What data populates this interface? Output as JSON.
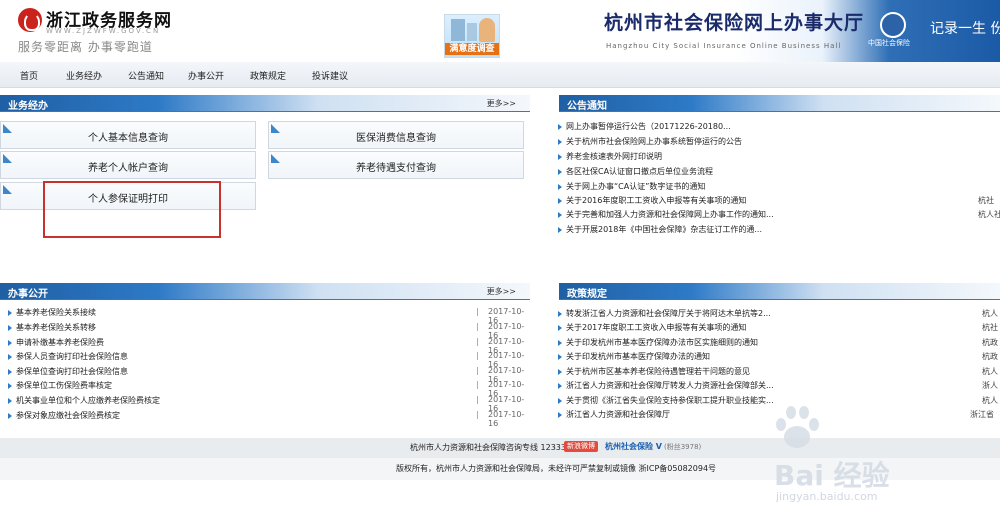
{
  "header": {
    "logo_name": "浙江政务服务网",
    "logo_url": "WWW.ZJZWFW.GOV.CN",
    "slogan": "服务零距离 办事零跑道",
    "badge_text": "满意度调查",
    "banner_title": "杭州市社会保险网上办事大厅",
    "banner_subtitle": "Hangzhou City Social Insurance Online Business Hall",
    "si_logo_text": "中国社会保险",
    "banner_right": "记录一生 份"
  },
  "nav": {
    "items": [
      "首页",
      "业务经办",
      "公告通知",
      "办事公开",
      "政策规定",
      "投诉建议"
    ]
  },
  "business": {
    "title": "业务经办",
    "more": "更多>>",
    "services": [
      "个人基本信息查询",
      "医保消费信息查询",
      "养老个人帐户查询",
      "养老待遇支付查询",
      "个人参保证明打印"
    ]
  },
  "notices": {
    "title": "公告通知",
    "more": "更多>>",
    "items": [
      {
        "text": "网上办事暂停运行公告（20171226-20180...",
        "src": ""
      },
      {
        "text": "关于杭州市社会保险网上办事系统暂停运行的公告",
        "src": ""
      },
      {
        "text": "养老金核速表外网打印说明",
        "src": ""
      },
      {
        "text": "各区社保CA认证窗口撤点后单位业务流程",
        "src": ""
      },
      {
        "text": "关于网上办事“CA认证”数字证书的通知",
        "src": ""
      },
      {
        "text": "关于2016年度职工工资收入申报等有关事项的通知",
        "src": "杭社"
      },
      {
        "text": "关于完善和加强人力资源和社会保障网上办事工作的通知...",
        "src": "杭人社"
      },
      {
        "text": "关于开展2018年《中国社会保障》杂志征订工作的通...",
        "src": ""
      }
    ]
  },
  "disclosure": {
    "title": "办事公开",
    "more": "更多>>",
    "separator": "|",
    "rows": [
      {
        "title": "基本养老保险关系接续",
        "date": "2017-10-16"
      },
      {
        "title": "基本养老保险关系转移",
        "date": "2017-10-16"
      },
      {
        "title": "申请补缴基本养老保险费",
        "date": "2017-10-16"
      },
      {
        "title": "参保人员查询打印社会保险信息",
        "date": "2017-10-16"
      },
      {
        "title": "参保单位查询打印社会保险信息",
        "date": "2017-10-16"
      },
      {
        "title": "参保单位工伤保险费率核定",
        "date": "2017-10-16"
      },
      {
        "title": "机关事业单位和个人应缴养老保险费核定",
        "date": "2017-10-16"
      },
      {
        "title": "参保对象应缴社会保险费核定",
        "date": "2017-10-16"
      }
    ]
  },
  "policy": {
    "title": "政策规定",
    "more": "更多>>",
    "items": [
      {
        "text": "转发浙江省人力资源和社会保障厅关于将阿达木单抗等2...",
        "src": "杭人"
      },
      {
        "text": "关于2017年度职工工资收入申报等有关事项的通知",
        "src": "杭社"
      },
      {
        "text": "关于印发杭州市基本医疗保障办法市区实施细则的通知",
        "src": "杭政"
      },
      {
        "text": "关于印发杭州市基本医疗保障办法的通知",
        "src": "杭政"
      },
      {
        "text": "关于杭州市区基本养老保险待遇管理若干问题的意见",
        "src": "杭人"
      },
      {
        "text": "浙江省人力资源和社会保障厅转发人力资源社会保障部关...",
        "src": "浙人"
      },
      {
        "text": "关于贯彻《浙江省失业保险支持参保职工提升职业技能实...",
        "src": "杭人"
      },
      {
        "text": "浙江省人力资源和社会保障厅",
        "src": "浙江省"
      }
    ]
  },
  "footer": {
    "hotline": "杭州市人力资源和社会保障咨询专线 12333 |",
    "weibo": "新浪微博",
    "hz_social": "杭州社会保险 V",
    "fans": "(粉丝3978)",
    "copyright": "版权所有，杭州市人力资源和社会保障局，未经许可严禁复制或镜像 浙ICP备05082094号"
  },
  "watermark": {
    "text": "Bai 经验",
    "url": "jingyan.baidu.com"
  },
  "colors": {
    "accent": "#2e7ac7",
    "header_dark": "#1f5fa3",
    "highlight": "#c8322c"
  }
}
